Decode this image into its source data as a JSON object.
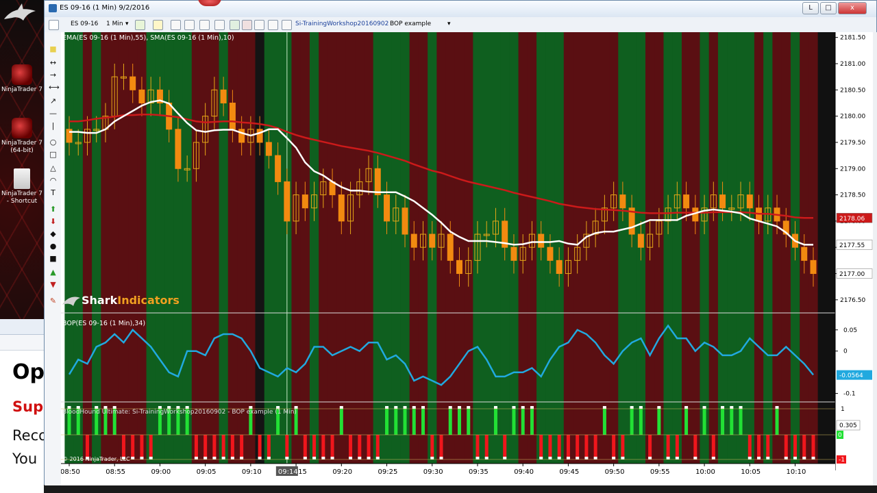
{
  "window": {
    "title": "ES 09-16 (1 Min)  9/2/2016",
    "controls": {
      "min": "L",
      "max": "□",
      "close": "x"
    }
  },
  "toolbar": {
    "instrument": "ES 09-16",
    "interval": "1 Min",
    "template": "Si-TrainingWorkshop20160902",
    "strategy": "BOP example"
  },
  "desktop": {
    "icons": [
      {
        "label": "NinjaTrader 7",
        "icon": "ninjatrader-icon"
      },
      {
        "label": "NinjaTrader 7 (64-bit)",
        "icon": "ninjatrader-icon"
      },
      {
        "label": "NinjaTrader 7 - Shortcut",
        "icon": "shortcut-file-icon"
      }
    ]
  },
  "background_doc": {
    "heading": "Op",
    "red": "Sup",
    "line1": "Reco",
    "line2": "You"
  },
  "chart": {
    "price_panel_label": "EMA(ES 09-16 (1 Min),55), SMA(ES 09-16 (1 Min),10)",
    "bop_panel_label": "BOP(ES 09-16 (1 Min),34)",
    "bloodhound_label": "BloodHound Ultimate: Si-TrainingWorkshop20160902 - BOP example (1 Min)",
    "copyright": "© 2016 NinjaTrader, LLC",
    "watermark_strong": "Shark",
    "watermark_rest": "Indicators",
    "crosshair_time": "09:14",
    "price_ticks": [
      "2181.50",
      "2181.00",
      "2180.50",
      "2180.00",
      "2179.50",
      "2179.00",
      "2178.50",
      "2178.00",
      "2177.50",
      "2177.00",
      "2176.50"
    ],
    "price_tags": {
      "ema": "2178.06",
      "sma": "2177.55",
      "last": "2177.00"
    },
    "bop_ticks": [
      "0.05",
      "0",
      "-0.1"
    ],
    "bop_value": "-0.0564",
    "bh_ticks": [
      "1",
      "0.305",
      "0",
      "-1"
    ],
    "time_ticks": [
      "08:50",
      "08:55",
      "09:00",
      "09:05",
      "09:10",
      "09:15",
      "09:20",
      "09:25",
      "09:30",
      "09:35",
      "09:40",
      "09:45",
      "09:50",
      "09:55",
      "10:00",
      "10:05",
      "10:10"
    ],
    "colors": {
      "up": "#e6a817",
      "down": "#f28a10",
      "ema": "#cc1a1a",
      "sma": "#ffffff",
      "bop": "#21a9df",
      "bg_green": "#0f5f1f",
      "bg_red": "#5a0f12",
      "signal_green": "#22e035",
      "signal_red": "#f0161c"
    }
  },
  "chart_data": {
    "type": "candlestick",
    "series": [
      {
        "name": "EMA(ES 09-16 (1 Min),55)"
      },
      {
        "name": "SMA(ES 09-16 (1 Min),10)"
      },
      {
        "name": "BOP(ES 09-16 (1 Min),34)"
      }
    ],
    "x": [
      "08:50",
      "08:51",
      "08:52",
      "08:53",
      "08:54",
      "08:55",
      "08:56",
      "08:57",
      "08:58",
      "08:59",
      "09:00",
      "09:01",
      "09:02",
      "09:03",
      "09:04",
      "09:05",
      "09:06",
      "09:07",
      "09:08",
      "09:09",
      "09:10",
      "09:11",
      "09:12",
      "09:13",
      "09:14",
      "09:15",
      "09:16",
      "09:17",
      "09:18",
      "09:19",
      "09:20",
      "09:21",
      "09:22",
      "09:23",
      "09:24",
      "09:25",
      "09:26",
      "09:27",
      "09:28",
      "09:29",
      "09:30",
      "09:31",
      "09:32",
      "09:33",
      "09:34",
      "09:35",
      "09:36",
      "09:37",
      "09:38",
      "09:39",
      "09:40",
      "09:41",
      "09:42",
      "09:43",
      "09:44",
      "09:45",
      "09:46",
      "09:47",
      "09:48",
      "09:49",
      "09:50",
      "09:51",
      "09:52",
      "09:53",
      "09:54",
      "09:55",
      "09:56",
      "09:57",
      "09:58",
      "09:59",
      "10:00",
      "10:01",
      "10:02",
      "10:03",
      "10:04",
      "10:05",
      "10:06",
      "10:07",
      "10:08",
      "10:09",
      "10:10",
      "10:11",
      "10:12"
    ],
    "open": [
      2179.75,
      2179.5,
      2179.5,
      2179.75,
      2179.75,
      2180.0,
      2180.75,
      2180.75,
      2180.5,
      2180.25,
      2180.5,
      2180.25,
      2179.75,
      2179.0,
      2179.0,
      2179.5,
      2180.0,
      2180.5,
      2180.25,
      2179.75,
      2179.5,
      2179.75,
      2179.5,
      2179.25,
      2178.75,
      2178.0,
      2178.5,
      2178.25,
      2178.5,
      2178.75,
      2178.5,
      2178.0,
      2178.5,
      2178.75,
      2179.0,
      2178.5,
      2178.0,
      2178.25,
      2177.75,
      2177.5,
      2177.75,
      2177.5,
      2177.75,
      2177.25,
      2177.0,
      2177.25,
      2177.75,
      2177.75,
      2178.0,
      2177.5,
      2177.25,
      2177.5,
      2177.75,
      2177.5,
      2177.25,
      2177.0,
      2177.25,
      2177.5,
      2177.75,
      2178.0,
      2178.25,
      2178.5,
      2178.25,
      2177.75,
      2177.5,
      2177.75,
      2178.0,
      2178.25,
      2178.5,
      2178.25,
      2178.0,
      2178.25,
      2178.5,
      2178.25,
      2178.25,
      2178.5,
      2178.25,
      2178.0,
      2178.25,
      2178.0,
      2177.75,
      2177.5,
      2177.25
    ],
    "close": [
      2179.5,
      2179.5,
      2179.75,
      2179.75,
      2180.0,
      2180.75,
      2180.75,
      2180.5,
      2180.25,
      2180.5,
      2180.25,
      2179.75,
      2179.0,
      2179.0,
      2179.5,
      2180.0,
      2180.5,
      2180.25,
      2179.75,
      2179.5,
      2179.75,
      2179.5,
      2179.25,
      2178.75,
      2178.0,
      2178.5,
      2178.25,
      2178.5,
      2178.75,
      2178.5,
      2178.0,
      2178.5,
      2178.75,
      2179.0,
      2178.5,
      2178.0,
      2178.25,
      2177.75,
      2177.5,
      2177.75,
      2177.5,
      2177.75,
      2177.25,
      2177.0,
      2177.25,
      2177.75,
      2177.75,
      2178.0,
      2177.5,
      2177.25,
      2177.5,
      2177.75,
      2177.5,
      2177.25,
      2177.0,
      2177.25,
      2177.5,
      2177.75,
      2178.0,
      2178.25,
      2178.5,
      2178.25,
      2177.75,
      2177.5,
      2177.75,
      2178.0,
      2178.25,
      2178.5,
      2178.25,
      2178.0,
      2178.25,
      2178.5,
      2178.25,
      2178.25,
      2178.5,
      2178.25,
      2178.0,
      2178.25,
      2178.0,
      2177.75,
      2177.5,
      2177.25,
      2177.0
    ],
    "ema": [
      2179.9,
      2179.9,
      2179.92,
      2179.95,
      2179.97,
      2179.99,
      2180.02,
      2180.02,
      2180.03,
      2180.03,
      2180.02,
      2180.0,
      2179.98,
      2179.94,
      2179.9,
      2179.88,
      2179.89,
      2179.9,
      2179.9,
      2179.88,
      2179.87,
      2179.85,
      2179.82,
      2179.77,
      2179.7,
      2179.64,
      2179.59,
      2179.55,
      2179.51,
      2179.47,
      2179.43,
      2179.4,
      2179.37,
      2179.34,
      2179.3,
      2179.25,
      2179.2,
      2179.15,
      2179.08,
      2179.02,
      2178.96,
      2178.92,
      2178.86,
      2178.8,
      2178.75,
      2178.71,
      2178.67,
      2178.63,
      2178.59,
      2178.54,
      2178.5,
      2178.46,
      2178.42,
      2178.38,
      2178.33,
      2178.3,
      2178.27,
      2178.25,
      2178.23,
      2178.22,
      2178.21,
      2178.2,
      2178.18,
      2178.16,
      2178.15,
      2178.15,
      2178.15,
      2178.16,
      2178.16,
      2178.16,
      2178.16,
      2178.17,
      2178.17,
      2178.17,
      2178.17,
      2178.16,
      2178.14,
      2178.14,
      2178.12,
      2178.1,
      2178.07,
      2178.06,
      2178.06
    ],
    "sma": [
      2179.7,
      2179.7,
      2179.68,
      2179.68,
      2179.75,
      2179.9,
      2180.0,
      2180.1,
      2180.2,
      2180.27,
      2180.3,
      2180.24,
      2180.05,
      2179.87,
      2179.73,
      2179.7,
      2179.73,
      2179.74,
      2179.74,
      2179.68,
      2179.63,
      2179.68,
      2179.75,
      2179.75,
      2179.58,
      2179.4,
      2179.12,
      2178.95,
      2178.87,
      2178.75,
      2178.65,
      2178.58,
      2178.58,
      2178.56,
      2178.55,
      2178.55,
      2178.55,
      2178.47,
      2178.38,
      2178.25,
      2178.12,
      2177.97,
      2177.8,
      2177.7,
      2177.62,
      2177.62,
      2177.62,
      2177.6,
      2177.58,
      2177.55,
      2177.56,
      2177.6,
      2177.6,
      2177.6,
      2177.62,
      2177.57,
      2177.55,
      2177.7,
      2177.77,
      2177.8,
      2177.8,
      2177.84,
      2177.88,
      2177.95,
      2178.02,
      2178.02,
      2178.02,
      2178.02,
      2178.1,
      2178.15,
      2178.2,
      2178.22,
      2178.2,
      2178.18,
      2178.15,
      2178.05,
      2178.0,
      2177.95,
      2177.9,
      2177.78,
      2177.62,
      2177.55,
      2177.55
    ],
    "bop": [
      -0.055,
      -0.02,
      -0.03,
      0.01,
      0.02,
      0.04,
      0.02,
      0.05,
      0.03,
      0.01,
      -0.02,
      -0.05,
      -0.06,
      0.0,
      0.0,
      -0.01,
      0.03,
      0.04,
      0.04,
      0.03,
      0.0,
      -0.04,
      -0.05,
      -0.06,
      -0.04,
      -0.05,
      -0.03,
      0.01,
      0.01,
      -0.01,
      0.0,
      0.01,
      0.0,
      0.02,
      0.02,
      -0.02,
      -0.01,
      -0.03,
      -0.07,
      -0.06,
      -0.07,
      -0.08,
      -0.06,
      -0.03,
      0.0,
      0.01,
      -0.02,
      -0.06,
      -0.06,
      -0.05,
      -0.05,
      -0.04,
      -0.06,
      -0.02,
      0.01,
      0.02,
      0.05,
      0.04,
      0.02,
      -0.01,
      -0.03,
      0.0,
      0.02,
      0.03,
      -0.01,
      0.03,
      0.06,
      0.03,
      0.03,
      0.0,
      0.02,
      0.01,
      -0.01,
      -0.01,
      0.0,
      0.03,
      0.01,
      -0.01,
      -0.01,
      0.01,
      -0.01,
      -0.03,
      -0.056
    ],
    "ylim_price": [
      2176.25,
      2181.6
    ],
    "ylim_bop": [
      -0.12,
      0.09
    ],
    "background_regime": "gGRGRRRRRGGGGGRRRGRRRBGGGRRGRRRRRRGGGGRRGRRRRGGGGGRRGGGRRRRRRGGGRRGGRRGRGGGGRGRRGRR",
    "signals": "GGRGGGRRRRGGGGRRRRRRGRRGRGRRRRGRRRRGGGGGRRGGGRRGRGGGRRRRRRRGRRGGRGRRGRGRGGGRRRGRRRR"
  }
}
